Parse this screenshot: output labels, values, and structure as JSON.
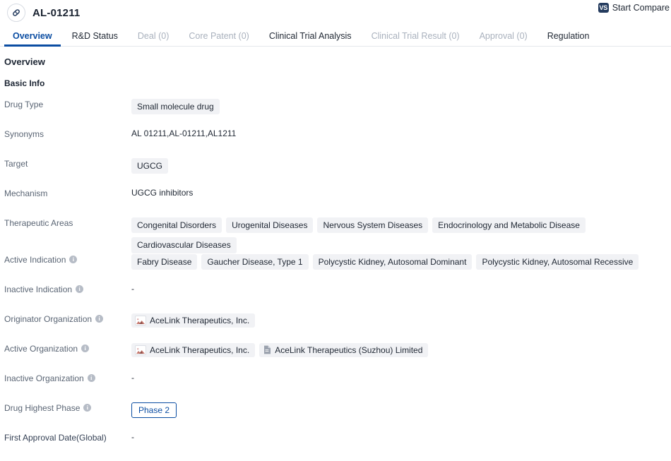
{
  "header": {
    "drug_icon": "capsule-icon",
    "title": "AL-01211",
    "compare": {
      "badge_text": "VS",
      "label": "Start Compare"
    }
  },
  "tabs": [
    {
      "label": "Overview",
      "state": "active"
    },
    {
      "label": "R&D Status",
      "state": "enabled"
    },
    {
      "label": "Deal (0)",
      "state": "disabled"
    },
    {
      "label": "Core Patent (0)",
      "state": "disabled"
    },
    {
      "label": "Clinical Trial Analysis",
      "state": "enabled"
    },
    {
      "label": "Clinical Trial Result (0)",
      "state": "disabled"
    },
    {
      "label": "Approval (0)",
      "state": "disabled"
    },
    {
      "label": "Regulation",
      "state": "enabled"
    }
  ],
  "overview": {
    "section_title": "Overview",
    "basic_info_title": "Basic Info",
    "rows": [
      {
        "label": "Drug Type",
        "has_info": false,
        "type": "chips",
        "values": [
          "Small molecule drug"
        ]
      },
      {
        "label": "Synonyms",
        "has_info": false,
        "type": "text",
        "text": "AL 01211,AL-01211,AL1211"
      },
      {
        "label": "Target",
        "has_info": false,
        "type": "chips",
        "values": [
          "UGCG"
        ]
      },
      {
        "label": "Mechanism",
        "has_info": false,
        "type": "text",
        "text": "UGCG inhibitors"
      },
      {
        "label": "Therapeutic Areas",
        "has_info": false,
        "type": "chips",
        "values": [
          "Congenital Disorders",
          "Urogenital Diseases",
          "Nervous System Diseases",
          "Endocrinology and Metabolic Disease",
          "Cardiovascular Diseases"
        ]
      },
      {
        "label": "Active Indication",
        "has_info": true,
        "type": "chips",
        "values": [
          "Fabry Disease",
          "Gaucher Disease, Type 1",
          "Polycystic Kidney, Autosomal Dominant",
          "Polycystic Kidney, Autosomal Recessive"
        ]
      },
      {
        "label": "Inactive Indication",
        "has_info": true,
        "type": "text",
        "text": "-"
      },
      {
        "label": "Originator Organization",
        "has_info": true,
        "type": "orgs",
        "orgs": [
          {
            "name": "AceLink Therapeutics, Inc.",
            "icon": "company-logo-icon"
          }
        ]
      },
      {
        "label": "Active Organization",
        "has_info": true,
        "type": "orgs",
        "orgs": [
          {
            "name": "AceLink Therapeutics, Inc.",
            "icon": "company-logo-icon"
          },
          {
            "name": "AceLink Therapeutics (Suzhou) Limited",
            "icon": "document-icon"
          }
        ]
      },
      {
        "label": "Inactive Organization",
        "has_info": true,
        "type": "text",
        "text": "-"
      },
      {
        "label": "Drug Highest Phase",
        "has_info": true,
        "type": "phase",
        "phase": "Phase 2"
      },
      {
        "label": "First Approval Date(Global)",
        "has_info": false,
        "label_dark": true,
        "type": "text",
        "text": "-"
      }
    ]
  },
  "colors": {
    "accent_blue": "#0b4da2",
    "chip_bg": "#f1f2f5",
    "label_gray": "#5a6574",
    "disabled_tab": "#a9b1bd",
    "vs_badge": "#243b5e"
  }
}
